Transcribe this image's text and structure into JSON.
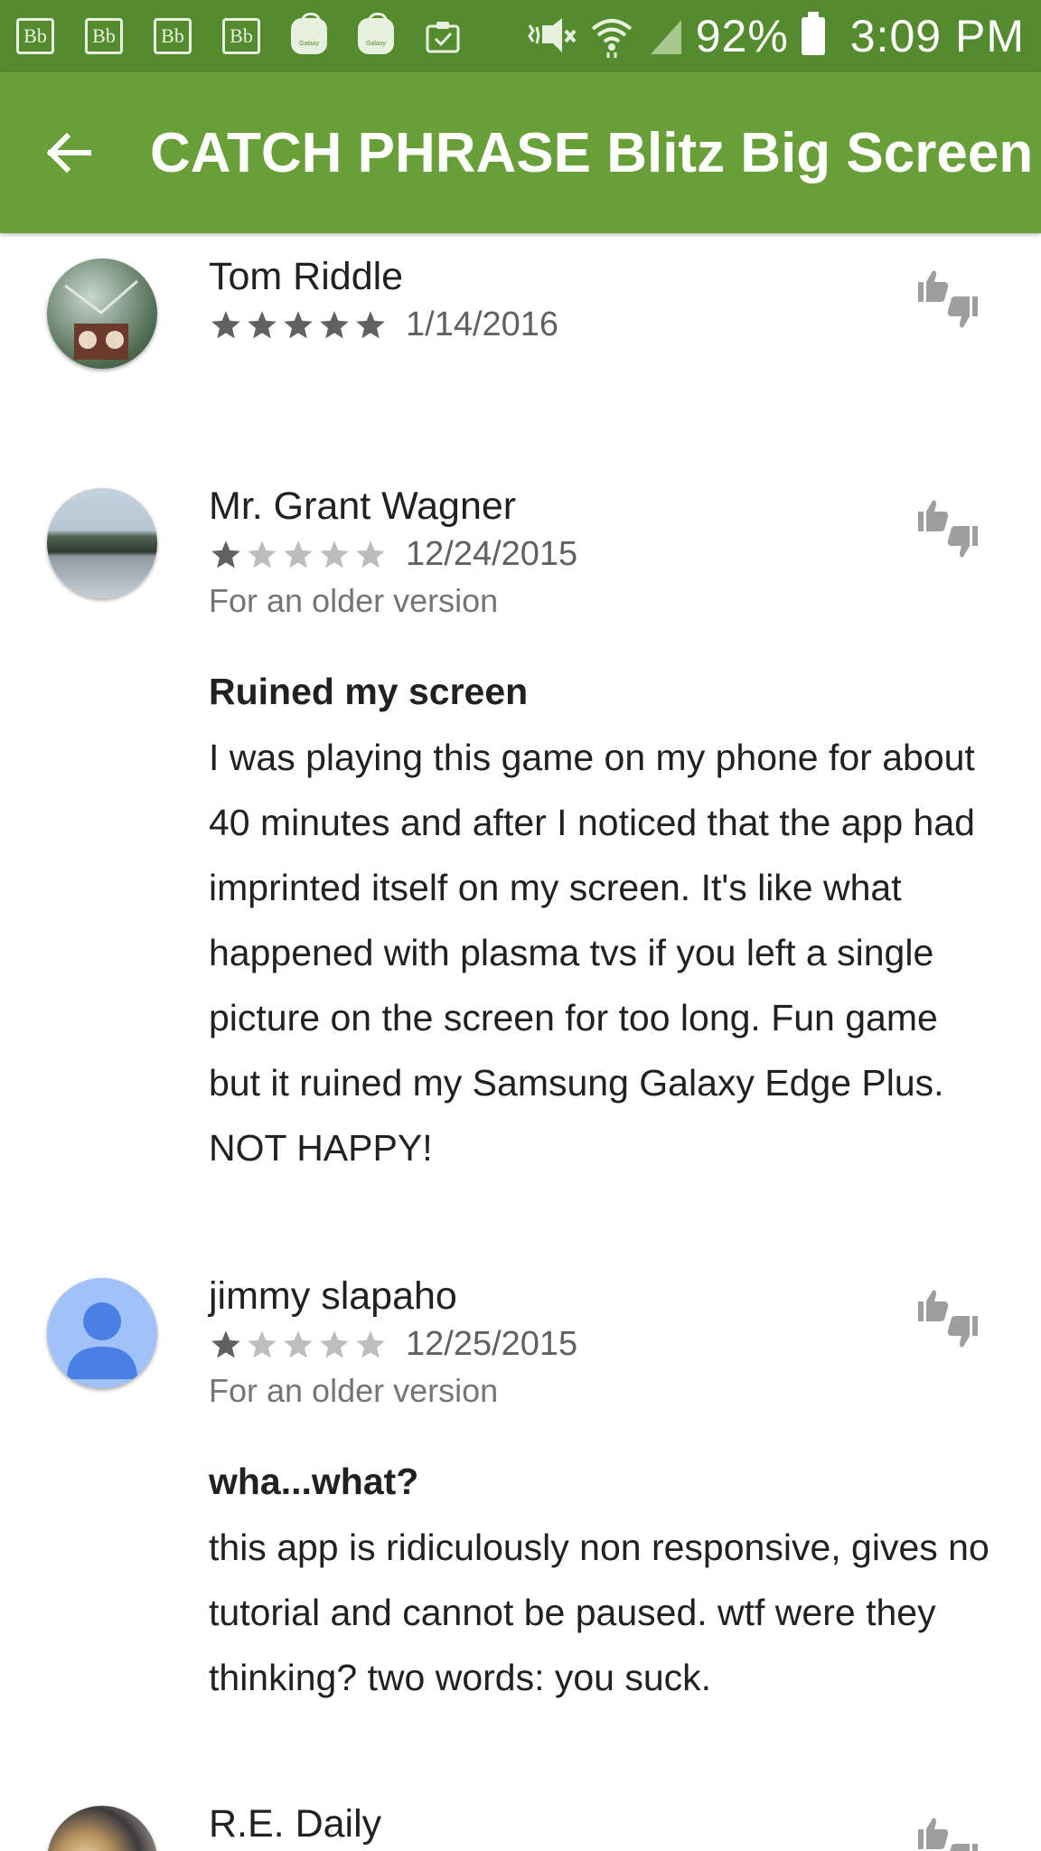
{
  "status_bar": {
    "notification_icons": [
      "bb-icon",
      "bb-icon",
      "bb-icon",
      "bb-icon",
      "galaxy-apps-icon",
      "galaxy-apps-icon",
      "clipboard-check-icon"
    ],
    "bb_label": "Bb",
    "galaxy_label": "Galaxy",
    "battery_percent": "92%",
    "time": "3:09 PM"
  },
  "app_bar": {
    "title": "CATCH PHRASE Blitz Big Screen",
    "back_icon": "arrow-back-icon"
  },
  "colors": {
    "status_bar": "#548b2e",
    "app_bar": "#689f38",
    "star_filled": "#616161",
    "star_empty": "#bdbdbd"
  },
  "reviews": [
    {
      "author": "Tom Riddle",
      "rating": 5,
      "date": "1/14/2016",
      "version_note": "",
      "title": "",
      "body": ""
    },
    {
      "author": "Mr. Grant Wagner",
      "rating": 1,
      "date": "12/24/2015",
      "version_note": "For an older version",
      "title": "Ruined my screen",
      "body": "I was playing this game on my phone for about 40 minutes and after I noticed that the app had imprinted itself on my screen. It's like what happened with plasma tvs if you left a single picture on the screen for too long. Fun game but it ruined my Samsung Galaxy Edge Plus. NOT HAPPY!"
    },
    {
      "author": "jimmy slapaho",
      "rating": 1,
      "date": "12/25/2015",
      "version_note": "For an older version",
      "title": "wha...what?",
      "body": "this app is ridiculously non responsive, gives no tutorial and cannot be paused. wtf were they thinking? two words: you suck."
    },
    {
      "author": "R.E. Daily",
      "rating": null,
      "date": "",
      "version_note": "",
      "title": "",
      "body": ""
    }
  ]
}
